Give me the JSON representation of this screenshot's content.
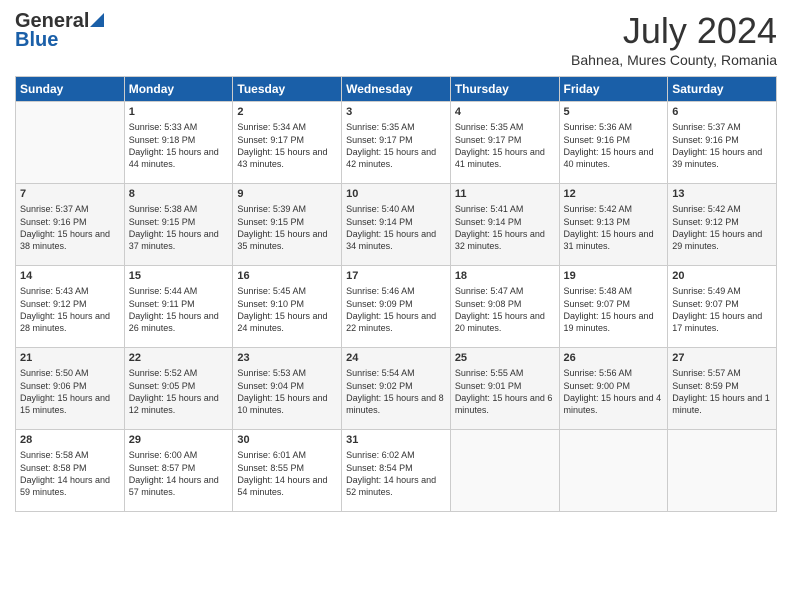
{
  "header": {
    "logo_general": "General",
    "logo_blue": "Blue",
    "month_title": "July 2024",
    "location": "Bahnea, Mures County, Romania"
  },
  "days_of_week": [
    "Sunday",
    "Monday",
    "Tuesday",
    "Wednesday",
    "Thursday",
    "Friday",
    "Saturday"
  ],
  "weeks": [
    {
      "days": [
        {
          "num": "",
          "empty": true
        },
        {
          "num": "1",
          "sunrise": "5:33 AM",
          "sunset": "9:18 PM",
          "daylight": "15 hours and 44 minutes."
        },
        {
          "num": "2",
          "sunrise": "5:34 AM",
          "sunset": "9:17 PM",
          "daylight": "15 hours and 43 minutes."
        },
        {
          "num": "3",
          "sunrise": "5:35 AM",
          "sunset": "9:17 PM",
          "daylight": "15 hours and 42 minutes."
        },
        {
          "num": "4",
          "sunrise": "5:35 AM",
          "sunset": "9:17 PM",
          "daylight": "15 hours and 41 minutes."
        },
        {
          "num": "5",
          "sunrise": "5:36 AM",
          "sunset": "9:16 PM",
          "daylight": "15 hours and 40 minutes."
        },
        {
          "num": "6",
          "sunrise": "5:37 AM",
          "sunset": "9:16 PM",
          "daylight": "15 hours and 39 minutes."
        }
      ]
    },
    {
      "days": [
        {
          "num": "7",
          "sunrise": "5:37 AM",
          "sunset": "9:16 PM",
          "daylight": "15 hours and 38 minutes."
        },
        {
          "num": "8",
          "sunrise": "5:38 AM",
          "sunset": "9:15 PM",
          "daylight": "15 hours and 37 minutes."
        },
        {
          "num": "9",
          "sunrise": "5:39 AM",
          "sunset": "9:15 PM",
          "daylight": "15 hours and 35 minutes."
        },
        {
          "num": "10",
          "sunrise": "5:40 AM",
          "sunset": "9:14 PM",
          "daylight": "15 hours and 34 minutes."
        },
        {
          "num": "11",
          "sunrise": "5:41 AM",
          "sunset": "9:14 PM",
          "daylight": "15 hours and 32 minutes."
        },
        {
          "num": "12",
          "sunrise": "5:42 AM",
          "sunset": "9:13 PM",
          "daylight": "15 hours and 31 minutes."
        },
        {
          "num": "13",
          "sunrise": "5:42 AM",
          "sunset": "9:12 PM",
          "daylight": "15 hours and 29 minutes."
        }
      ]
    },
    {
      "days": [
        {
          "num": "14",
          "sunrise": "5:43 AM",
          "sunset": "9:12 PM",
          "daylight": "15 hours and 28 minutes."
        },
        {
          "num": "15",
          "sunrise": "5:44 AM",
          "sunset": "9:11 PM",
          "daylight": "15 hours and 26 minutes."
        },
        {
          "num": "16",
          "sunrise": "5:45 AM",
          "sunset": "9:10 PM",
          "daylight": "15 hours and 24 minutes."
        },
        {
          "num": "17",
          "sunrise": "5:46 AM",
          "sunset": "9:09 PM",
          "daylight": "15 hours and 22 minutes."
        },
        {
          "num": "18",
          "sunrise": "5:47 AM",
          "sunset": "9:08 PM",
          "daylight": "15 hours and 20 minutes."
        },
        {
          "num": "19",
          "sunrise": "5:48 AM",
          "sunset": "9:07 PM",
          "daylight": "15 hours and 19 minutes."
        },
        {
          "num": "20",
          "sunrise": "5:49 AM",
          "sunset": "9:07 PM",
          "daylight": "15 hours and 17 minutes."
        }
      ]
    },
    {
      "days": [
        {
          "num": "21",
          "sunrise": "5:50 AM",
          "sunset": "9:06 PM",
          "daylight": "15 hours and 15 minutes."
        },
        {
          "num": "22",
          "sunrise": "5:52 AM",
          "sunset": "9:05 PM",
          "daylight": "15 hours and 12 minutes."
        },
        {
          "num": "23",
          "sunrise": "5:53 AM",
          "sunset": "9:04 PM",
          "daylight": "15 hours and 10 minutes."
        },
        {
          "num": "24",
          "sunrise": "5:54 AM",
          "sunset": "9:02 PM",
          "daylight": "15 hours and 8 minutes."
        },
        {
          "num": "25",
          "sunrise": "5:55 AM",
          "sunset": "9:01 PM",
          "daylight": "15 hours and 6 minutes."
        },
        {
          "num": "26",
          "sunrise": "5:56 AM",
          "sunset": "9:00 PM",
          "daylight": "15 hours and 4 minutes."
        },
        {
          "num": "27",
          "sunrise": "5:57 AM",
          "sunset": "8:59 PM",
          "daylight": "15 hours and 1 minute."
        }
      ]
    },
    {
      "days": [
        {
          "num": "28",
          "sunrise": "5:58 AM",
          "sunset": "8:58 PM",
          "daylight": "14 hours and 59 minutes."
        },
        {
          "num": "29",
          "sunrise": "6:00 AM",
          "sunset": "8:57 PM",
          "daylight": "14 hours and 57 minutes."
        },
        {
          "num": "30",
          "sunrise": "6:01 AM",
          "sunset": "8:55 PM",
          "daylight": "14 hours and 54 minutes."
        },
        {
          "num": "31",
          "sunrise": "6:02 AM",
          "sunset": "8:54 PM",
          "daylight": "14 hours and 52 minutes."
        },
        {
          "num": "",
          "empty": true
        },
        {
          "num": "",
          "empty": true
        },
        {
          "num": "",
          "empty": true
        }
      ]
    }
  ],
  "labels": {
    "sunrise": "Sunrise:",
    "sunset": "Sunset:",
    "daylight": "Daylight:"
  }
}
